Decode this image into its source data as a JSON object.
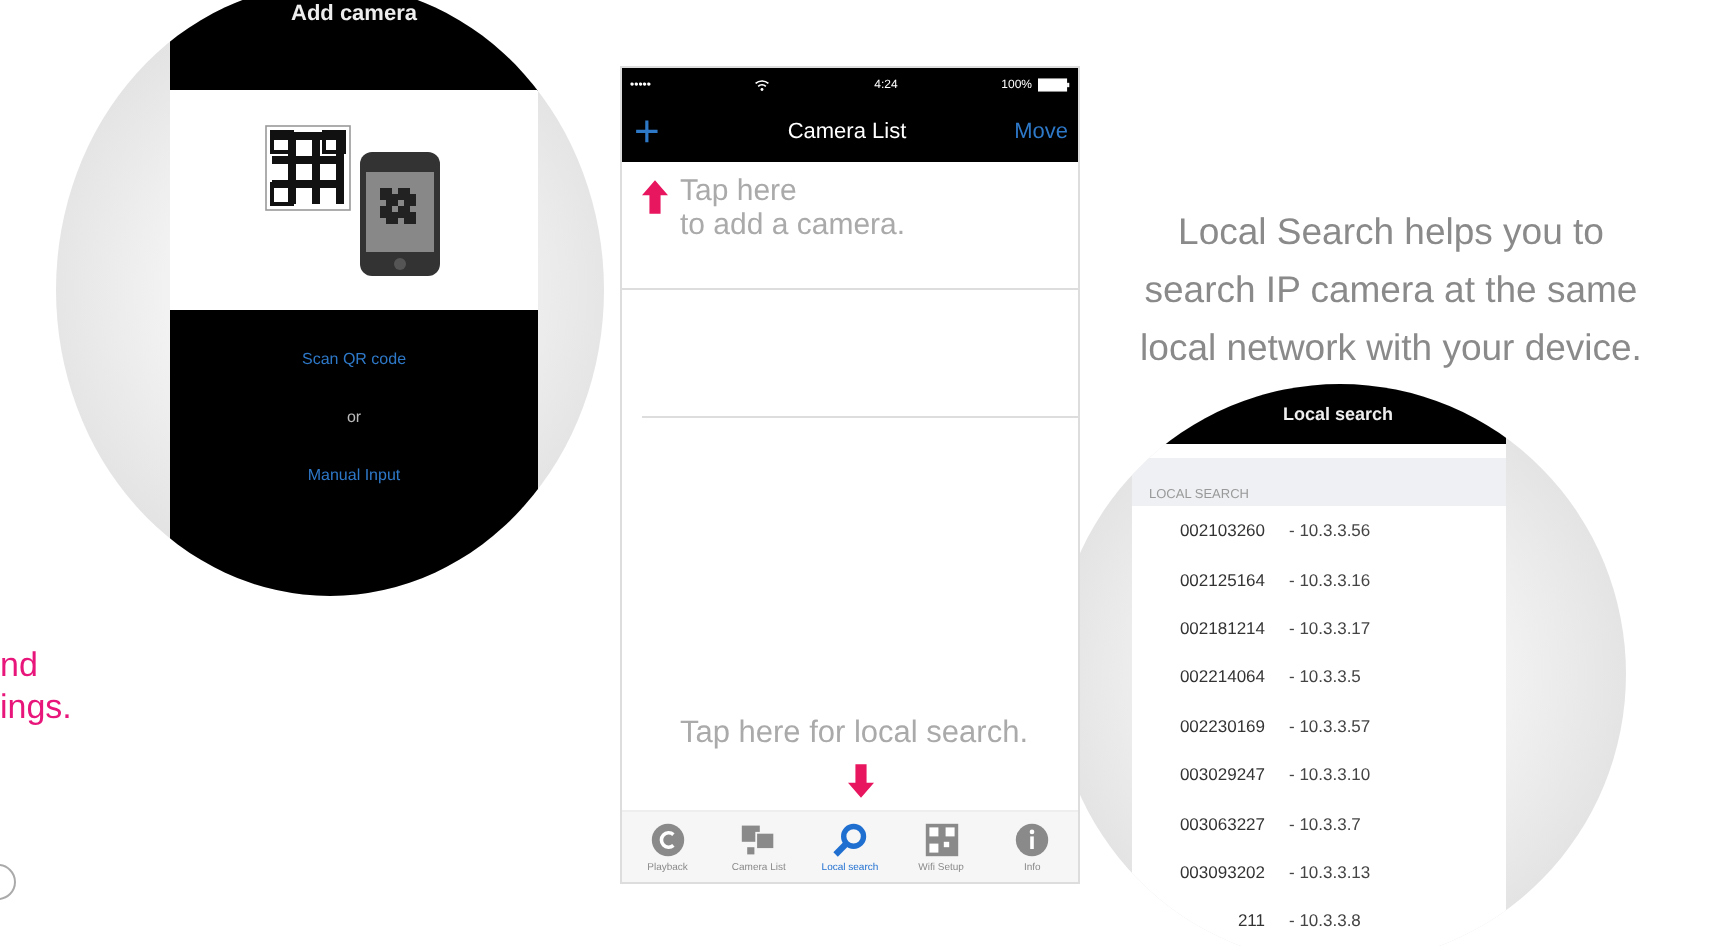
{
  "side_text": [
    "nd",
    "ings."
  ],
  "add_camera_screen": {
    "title": "Add camera",
    "options": [
      {
        "label": "Scan QR code",
        "kind": "link"
      },
      {
        "label": "or",
        "kind": "text"
      },
      {
        "label": "Manual Input",
        "kind": "link"
      }
    ]
  },
  "camera_list_screen": {
    "status_bar": {
      "signal": "•••••",
      "time": "4:24",
      "battery": "100%"
    },
    "nav": {
      "add": "+",
      "title": "Camera List",
      "action": "Move"
    },
    "hint_add": [
      "Tap here",
      "to add a camera."
    ],
    "hint_search": "Tap here for local search.",
    "tabs": [
      {
        "label": "Playback",
        "kind": "playback",
        "selected": false
      },
      {
        "label": "Camera List",
        "kind": "cameras",
        "selected": false
      },
      {
        "label": "Local search",
        "kind": "search",
        "selected": true
      },
      {
        "label": "Wifi Setup",
        "kind": "qr",
        "selected": false
      },
      {
        "label": "Info",
        "kind": "info",
        "selected": false
      }
    ]
  },
  "description": {
    "lines": [
      "Local Search helps you to",
      "search IP camera at the same",
      "local network with your device."
    ]
  },
  "local_search_screen": {
    "title": "Local search",
    "section": "LOCAL SEARCH",
    "devices": [
      {
        "id": "002103260",
        "ip": "- 10.3.3.56"
      },
      {
        "id": "002125164",
        "ip": "- 10.3.3.16"
      },
      {
        "id": "002181214",
        "ip": "- 10.3.3.17"
      },
      {
        "id": "002214064",
        "ip": "- 10.3.3.5"
      },
      {
        "id": "002230169",
        "ip": "- 10.3.3.57"
      },
      {
        "id": "003029247",
        "ip": "- 10.3.3.10"
      },
      {
        "id": "003063227",
        "ip": "- 10.3.3.7"
      },
      {
        "id": "003093202",
        "ip": "- 10.3.3.13"
      },
      {
        "id": "211",
        "ip": "- 10.3.3.8"
      }
    ]
  }
}
